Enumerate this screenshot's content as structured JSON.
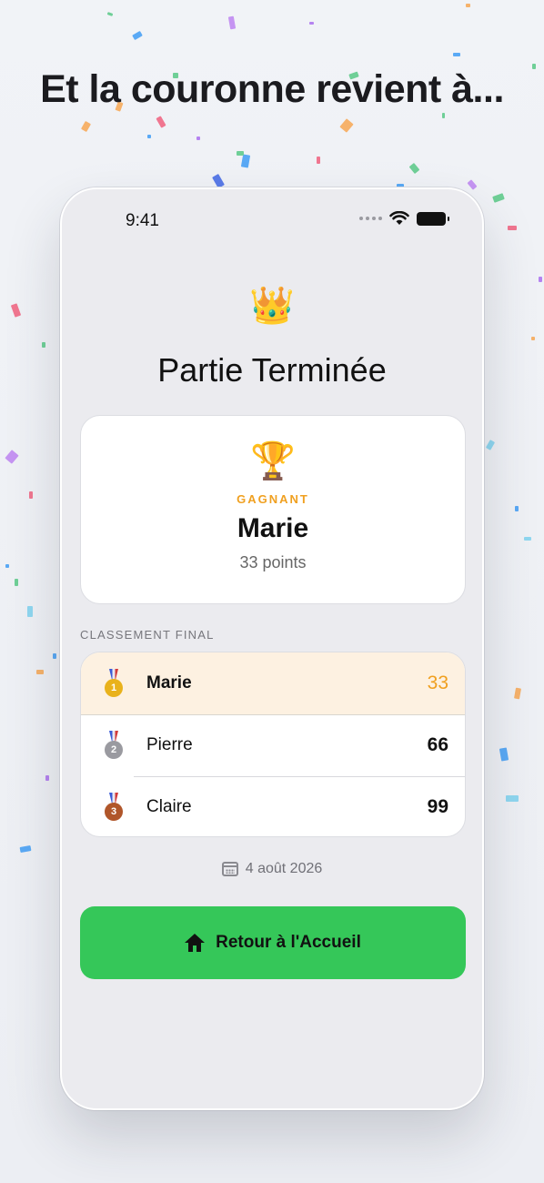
{
  "headline": "Et la couronne revient à...",
  "status_bar": {
    "time": "9:41"
  },
  "game": {
    "crown_emoji": "👑",
    "title": "Partie Terminée"
  },
  "winner": {
    "trophy_emoji": "🏆",
    "label": "GAGNANT",
    "name": "Marie",
    "points": "33 points"
  },
  "ranking": {
    "section_label": "CLASSEMENT FINAL",
    "rows": [
      {
        "rank": "1",
        "name": "Marie",
        "score": "33",
        "medal_color": "#e9b21b"
      },
      {
        "rank": "2",
        "name": "Pierre",
        "score": "66",
        "medal_color": "#9a9aa0"
      },
      {
        "rank": "3",
        "name": "Claire",
        "score": "99",
        "medal_color": "#b0562a"
      }
    ]
  },
  "date": "4 août 2026",
  "home_button": {
    "label": "Retour à l'Accueil"
  },
  "colors": {
    "accent_gold": "#f0a020",
    "button_green": "#35c759"
  }
}
